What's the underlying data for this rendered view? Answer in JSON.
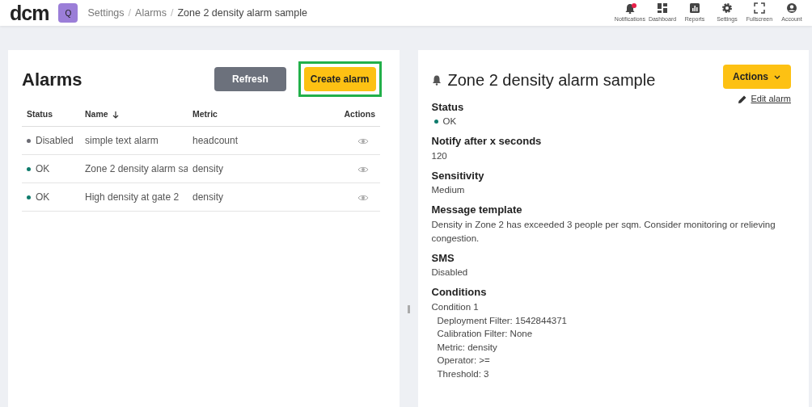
{
  "header": {
    "logo": "dcm",
    "workspace": "Q",
    "separator": "/",
    "breadcrumb": [
      {
        "label": "Settings"
      },
      {
        "label": "Alarms"
      },
      {
        "label": "Zone 2 density alarm sample"
      }
    ],
    "nav": [
      {
        "kind": "bell",
        "label": "Notifications",
        "badge": true
      },
      {
        "kind": "dashboard",
        "label": "Dashboard",
        "badge": false
      },
      {
        "kind": "reports",
        "label": "Reports",
        "badge": false
      },
      {
        "kind": "settings",
        "label": "Settings",
        "badge": false
      },
      {
        "kind": "fullscreen",
        "label": "Fullscreen",
        "badge": false
      },
      {
        "kind": "account",
        "label": "Account",
        "badge": false
      }
    ]
  },
  "list": {
    "title": "Alarms",
    "buttons": [
      {
        "kind": "secondary",
        "label": "Refresh",
        "highlighted": false
      },
      {
        "kind": "primary",
        "label": "Create alarm",
        "highlighted": true
      }
    ],
    "columns": [
      "Status",
      "Name",
      "Metric",
      "Actions"
    ],
    "rows": [
      {
        "status": "Disabled",
        "color": "#6c6c74",
        "name": "simple text alarm",
        "metric": "headcount"
      },
      {
        "status": "OK",
        "color": "#0f7b6c",
        "name": "Zone 2 density alarm sa",
        "metric": "density"
      },
      {
        "status": "OK",
        "color": "#0f7b6c",
        "name": "High density at gate 2",
        "metric": "density"
      }
    ]
  },
  "detail": {
    "title": "Zone 2 density alarm sample",
    "actions": "Actions",
    "edit": "Edit alarm",
    "status": {
      "label": "Status",
      "value": "OK",
      "color": "#0f7b6c"
    },
    "fields": [
      {
        "label": "Notify after x seconds",
        "value": "120"
      },
      {
        "label": "Sensitivity",
        "value": "Medium"
      },
      {
        "label": "Message template",
        "value": "Density in Zone 2 has exceeded 3 people per sqm. Consider monitoring or relieving congestion."
      },
      {
        "label": "SMS",
        "value": "Disabled"
      }
    ],
    "conditions": {
      "label": "Conditions",
      "items": [
        {
          "title": "Condition 1",
          "lines": [
            "Deployment Filter: 1542844371",
            "Calibration Filter: None",
            "Metric: density",
            "Operator: >=",
            "Threshold: 3"
          ]
        }
      ]
    }
  }
}
